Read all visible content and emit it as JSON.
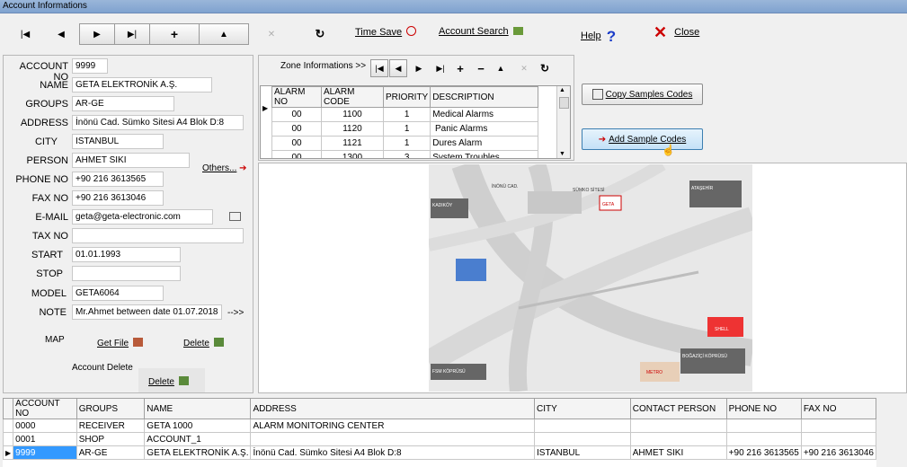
{
  "window": {
    "title": "Account Informations"
  },
  "toolbar": {
    "time_save": "Time Save",
    "account_search": "Account Search",
    "help": "Help",
    "close": "Close"
  },
  "form": {
    "labels": {
      "account_no": "ACCOUNT NO",
      "name": "NAME",
      "groups": "GROUPS",
      "address": "ADDRESS",
      "city": "CITY",
      "person": "PERSON",
      "phone_no": "PHONE NO",
      "fax_no": "FAX NO",
      "email": "E-MAIL",
      "tax_no": "TAX NO",
      "start": "START",
      "stop": "STOP",
      "model": "MODEL",
      "note": "NOTE",
      "map": "MAP",
      "account_delete": "Account Delete"
    },
    "values": {
      "account_no": "9999",
      "name": "GETA ELEKTRONİK A.Ş.",
      "groups": "AR-GE",
      "address": "İnönü Cad. Sümko Sitesi A4 Blok D:8",
      "city": "ISTANBUL",
      "person": "AHMET SIKI",
      "phone_no": "+90 216 3613565",
      "fax_no": "+90 216 3613046",
      "email": "geta@geta-electronic.com",
      "tax_no": "",
      "start": "01.01.1993",
      "stop": "",
      "model": "GETA6064",
      "note": "Mr.Ahmet between date 01.07.2018"
    },
    "others_link": "Others...",
    "note_more": "-->>",
    "get_file": "Get File",
    "delete": "Delete",
    "account_delete_btn": "Delete"
  },
  "zone": {
    "title": "Zone Informations >>",
    "headers": [
      "ALARM NO",
      "ALARM CODE",
      "PRIORITY",
      "DESCRIPTION"
    ],
    "rows": [
      [
        "00",
        "1100",
        "1",
        "Medical Alarms"
      ],
      [
        "00",
        "1120",
        "1",
        " Panic Alarms"
      ],
      [
        "00",
        "1121",
        "1",
        "Dures Alarm"
      ],
      [
        "00",
        "1300",
        "3",
        "System Troubles"
      ]
    ],
    "copy_samples": "Copy Samples Codes",
    "add_sample": "Add Sample Codes"
  },
  "map": {
    "labels": [
      "İNÖNÜ CAD.",
      "SÜMKO SİTESİ",
      "GETA",
      "KADIKÖY",
      "ATAŞEHİR",
      "SHELL",
      "METRO",
      "FSM KÖPRÜSÜ",
      "BOĞAZİÇİ KÖPRÜSÜ"
    ]
  },
  "accounts": {
    "headers": [
      "ACCOUNT NO",
      "GROUPS",
      "NAME",
      "ADDRESS",
      "CITY",
      "CONTACT PERSON",
      "PHONE NO",
      "FAX NO"
    ],
    "rows": [
      [
        "0000",
        "RECEIVER",
        "GETA 1000",
        "ALARM MONITORING CENTER",
        "",
        "",
        "",
        ""
      ],
      [
        "0001",
        "SHOP",
        "ACCOUNT_1",
        "",
        "",
        "",
        "",
        ""
      ],
      [
        "9999",
        "AR-GE",
        "GETA ELEKTRONİK A.Ş.",
        "İnönü Cad. Sümko Sitesi A4 Blok D:8",
        "ISTANBUL",
        "AHMET SIKI",
        "+90 216 3613565",
        "+90 216 3613046"
      ]
    ]
  },
  "colors": {
    "accent": "#3399ff",
    "title_bar": "#8eadd6",
    "close_x": "#cc0000",
    "help": "#1a3cc8"
  }
}
